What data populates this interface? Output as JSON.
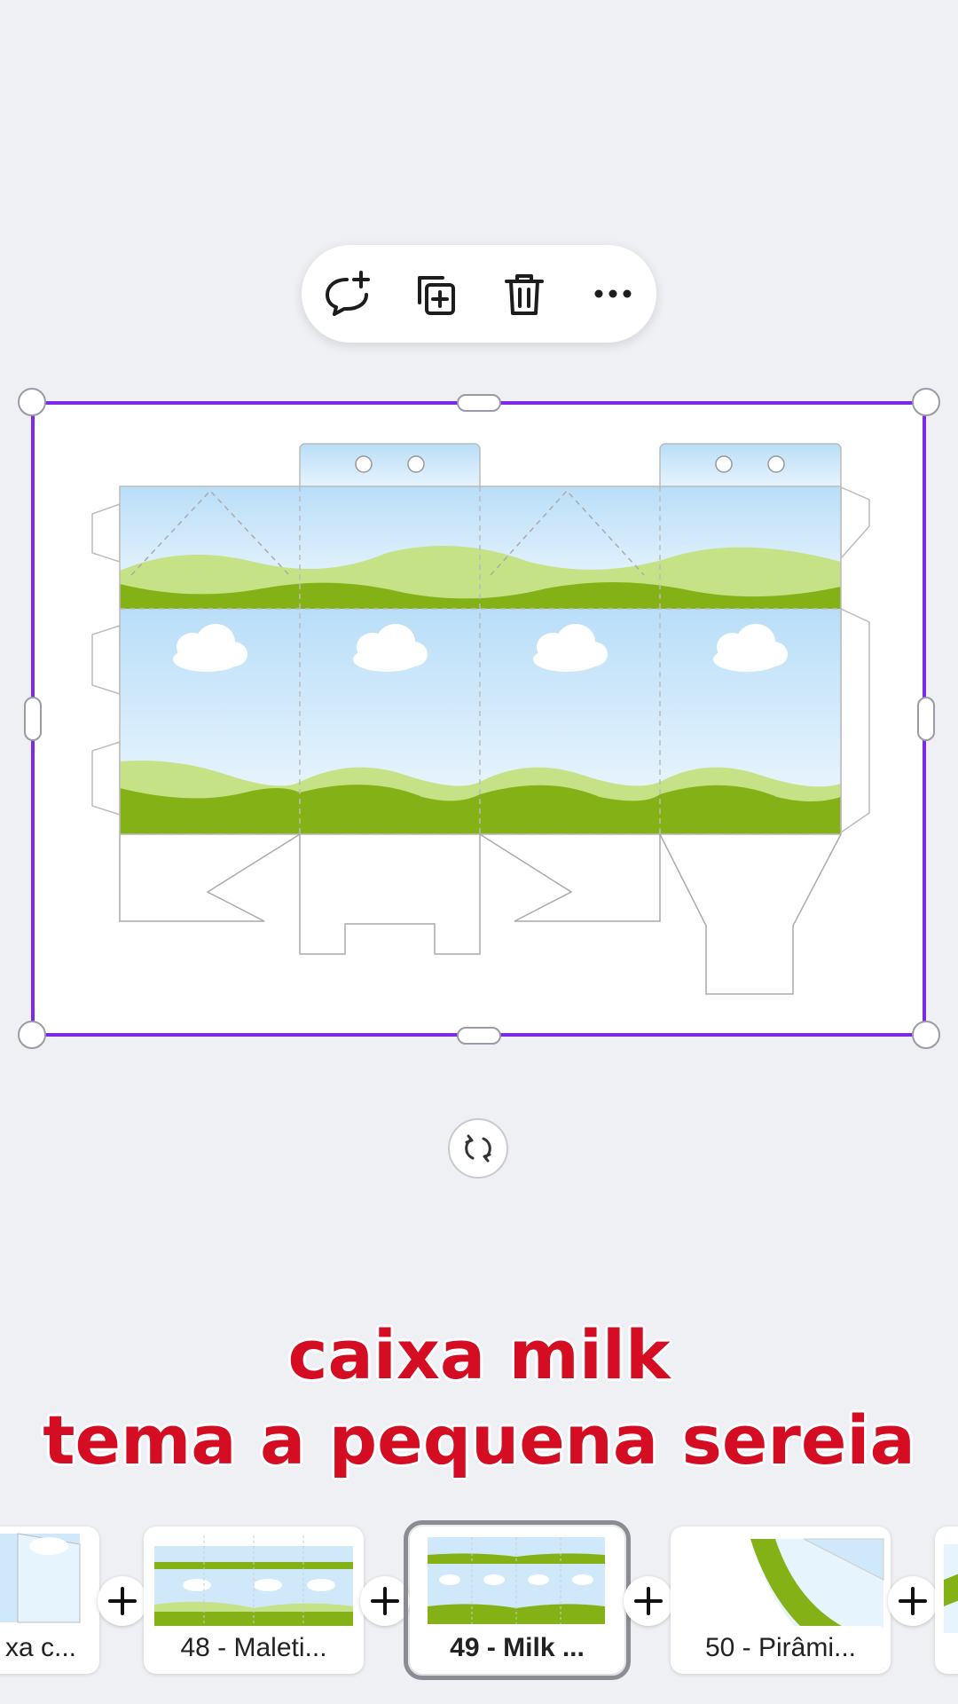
{
  "toolbar": {
    "icons": [
      "comment-add-icon",
      "duplicate-icon",
      "trash-icon",
      "more-icon"
    ]
  },
  "canvas": {
    "design": "milk box template with sky and green hills"
  },
  "caption": {
    "line1": "caixa milk",
    "line2": "tema a pequena sereia"
  },
  "pages": [
    {
      "label": "xa c..."
    },
    {
      "label": "48 - Maleti..."
    },
    {
      "label": "49 - Milk ...",
      "active": true
    },
    {
      "label": "50 - Pirâmi..."
    }
  ],
  "colors": {
    "selection": "#7d2ae8",
    "caption": "#d40d23",
    "grass": "#84b216",
    "sky": "#c8e6fa"
  }
}
